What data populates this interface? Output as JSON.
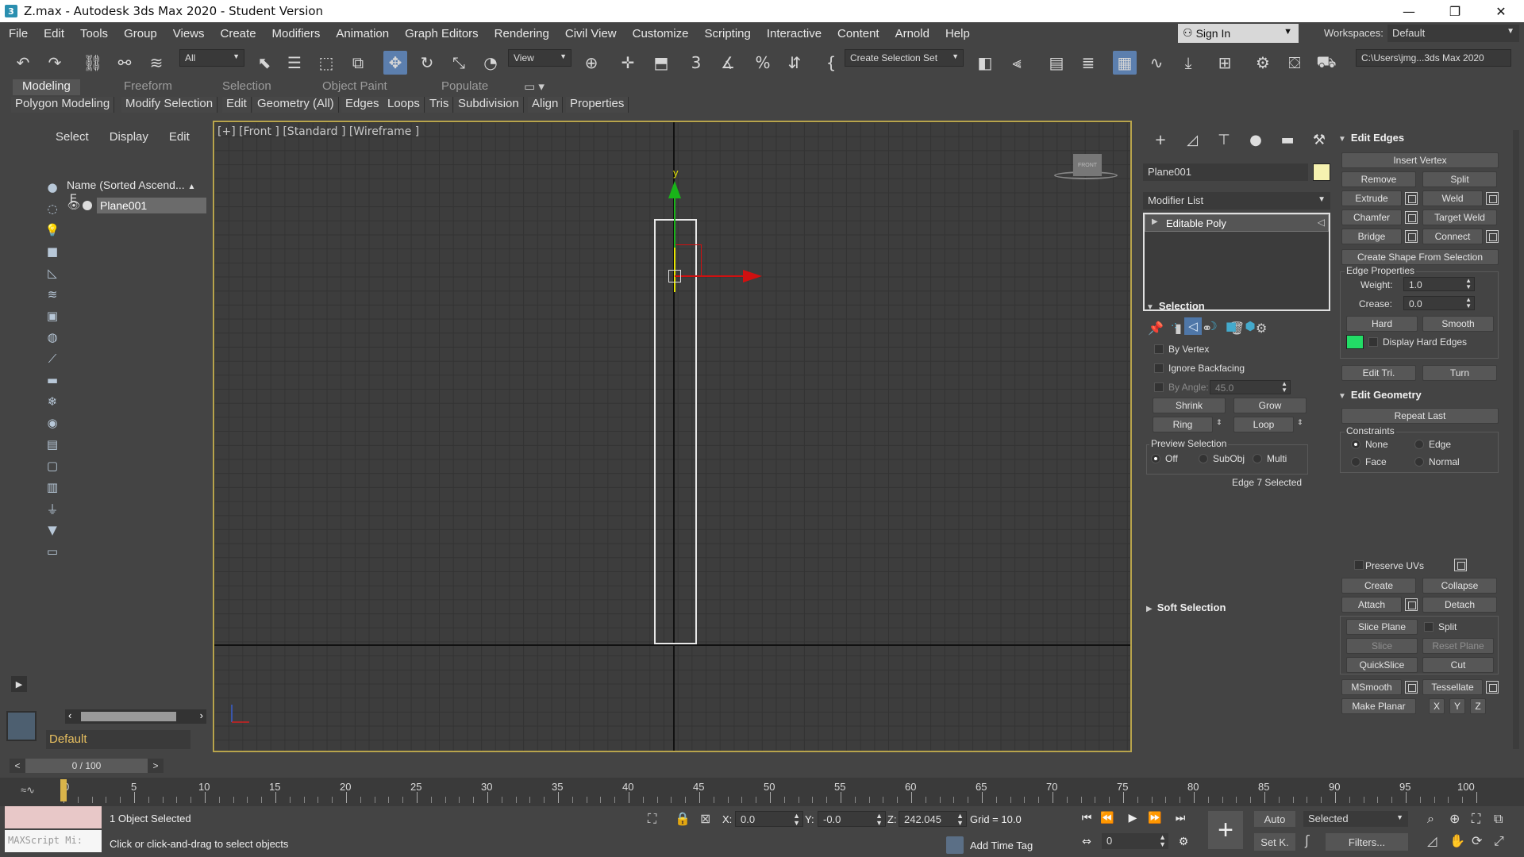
{
  "window": {
    "title": "Z.max - Autodesk 3ds Max 2020 - Student Version",
    "app_icon": "3",
    "minimize": "—",
    "maximize": "❐",
    "close": "✕"
  },
  "menubar": {
    "items": [
      "File",
      "Edit",
      "Tools",
      "Group",
      "Views",
      "Create",
      "Modifiers",
      "Animation",
      "Graph Editors",
      "Rendering",
      "Civil View",
      "Customize",
      "Scripting",
      "Interactive",
      "Content",
      "Arnold",
      "Help"
    ],
    "sign_in": "Sign In",
    "workspaces_label": "Workspaces:",
    "workspace_value": "Default"
  },
  "toolbar": {
    "selection_filter": "All",
    "ref_coord": "View",
    "named_selection": "Create Selection Set",
    "project_path": "C:\\Users\\jmg...3ds Max 2020"
  },
  "ribbon": {
    "tabs": [
      "Modeling",
      "Freeform",
      "Selection",
      "Object Paint",
      "Populate"
    ],
    "active_tab": "Modeling",
    "items": [
      "Polygon Modeling",
      "Modify Selection",
      "Edit",
      "Geometry (All)",
      "Edges",
      "Loops",
      "Tris",
      "Subdivision",
      "Align",
      "Properties"
    ]
  },
  "scene_explorer": {
    "menu": [
      "Select",
      "Display",
      "Edit"
    ],
    "column_header": "Name (Sorted Ascend...",
    "column_sort": "▲",
    "column_flag": "F",
    "objects": [
      {
        "name": "Plane001"
      }
    ],
    "layer": "Default"
  },
  "viewport": {
    "label": "[+] [Front ] [Standard ] [Wireframe ]",
    "y_axis_label": "y",
    "viewcube_label": "FRONT"
  },
  "command_panel": {
    "object_name": "Plane001",
    "object_color": "#f6f2b0",
    "modifier_list_label": "Modifier List",
    "stack": [
      {
        "name": "Editable Poly"
      }
    ],
    "edit_edges": {
      "title": "Edit Edges",
      "insert_vertex": "Insert Vertex",
      "remove": "Remove",
      "split": "Split",
      "extrude": "Extrude",
      "weld": "Weld",
      "chamfer": "Chamfer",
      "target_weld": "Target Weld",
      "bridge": "Bridge",
      "connect": "Connect",
      "create_shape": "Create Shape From Selection",
      "edge_properties": "Edge Properties",
      "weight_label": "Weight:",
      "weight_value": "1.0",
      "crease_label": "Crease:",
      "crease_value": "0.0",
      "hard": "Hard",
      "smooth": "Smooth",
      "display_hard_edges": "Display Hard Edges",
      "hard_edge_color": "#22dd66",
      "edit_tri": "Edit Tri.",
      "turn": "Turn"
    },
    "selection": {
      "title": "Selection",
      "by_vertex": "By Vertex",
      "ignore_backfacing": "Ignore Backfacing",
      "by_angle": "By Angle:",
      "by_angle_value": "45.0",
      "shrink": "Shrink",
      "grow": "Grow",
      "ring": "Ring",
      "loop": "Loop",
      "preview_selection": "Preview Selection",
      "preview_off": "Off",
      "preview_subobj": "SubObj",
      "preview_multi": "Multi",
      "status": "Edge 7 Selected"
    },
    "soft_selection": {
      "title": "Soft Selection"
    },
    "edit_geometry": {
      "title": "Edit Geometry",
      "repeat_last": "Repeat Last",
      "constraints": "Constraints",
      "none": "None",
      "edge": "Edge",
      "face": "Face",
      "normal": "Normal",
      "preserve_uvs": "Preserve UVs",
      "create": "Create",
      "collapse": "Collapse",
      "attach": "Attach",
      "detach": "Detach",
      "slice_plane": "Slice Plane",
      "split": "Split",
      "slice": "Slice",
      "reset_plane": "Reset Plane",
      "quickslice": "QuickSlice",
      "cut": "Cut",
      "msmooth": "MSmooth",
      "tessellate": "Tessellate",
      "make_planar": "Make Planar",
      "x": "X",
      "y": "Y",
      "z": "Z"
    }
  },
  "timeline": {
    "current": "0 / 100",
    "prev": "<",
    "next": ">",
    "ticks": [
      "0",
      "5",
      "10",
      "15",
      "20",
      "25",
      "30",
      "35",
      "40",
      "45",
      "50",
      "55",
      "60",
      "65",
      "70",
      "75",
      "80",
      "85",
      "90",
      "95",
      "100"
    ]
  },
  "status": {
    "maxscript": "MAXScript Mi:",
    "selection": "1 Object Selected",
    "prompt": "Click or click-and-drag to select objects",
    "x_label": "X:",
    "x_value": "0.0",
    "y_label": "Y:",
    "y_value": "-0.0",
    "z_label": "Z:",
    "z_value": "242.045",
    "grid": "Grid = 10.0",
    "add_time_tag": "Add Time Tag",
    "frame": "0",
    "auto": "Auto",
    "set_key": "Set K.",
    "key_filter_selected": "Selected",
    "filters": "Filters..."
  }
}
